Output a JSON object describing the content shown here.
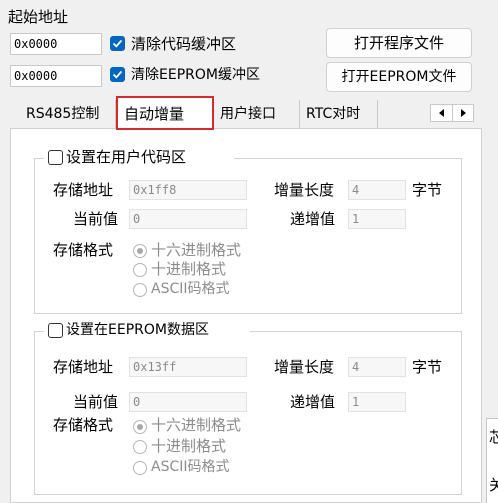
{
  "top": {
    "start_addr_label": "起始地址",
    "code_addr_value": "0x0000",
    "eeprom_addr_value": "0x0000",
    "clear_code_label": "清除代码缓冲区",
    "clear_eeprom_label": "清除EEPROM缓冲区",
    "open_program_label": "打开程序文件",
    "open_eeprom_label": "打开EEPROM文件"
  },
  "tabs": {
    "rs485": "RS485控制",
    "auto_inc": "自动增量",
    "user_if": "用户接口",
    "rtc": "RTC对时"
  },
  "code_group": {
    "title": "设置在用户代码区",
    "store_addr_label": "存储地址",
    "store_addr_value": "0x1ff8",
    "inc_len_label": "增量长度",
    "inc_len_value": "4",
    "unit": "字节",
    "current_label": "当前值",
    "current_value": "0",
    "step_label": "递增值",
    "step_value": "1",
    "format_label": "存储格式",
    "opt_hex": "十六进制格式",
    "opt_dec": "十进制格式",
    "opt_ascii": "ASCII码格式"
  },
  "eeprom_group": {
    "title": "设置在EEPROM数据区",
    "store_addr_label": "存储地址",
    "store_addr_value": "0x13ff",
    "inc_len_label": "增量长度",
    "inc_len_value": "4",
    "unit": "字节",
    "current_label": "当前值",
    "current_value": "0",
    "step_label": "递增值",
    "step_value": "1",
    "format_label": "存储格式",
    "opt_hex": "十六进制格式",
    "opt_dec": "十进制格式",
    "opt_ascii": "ASCII码格式"
  },
  "side": {
    "char_top": "芯",
    "char_bottom": "关"
  },
  "colors": {
    "accent": "#0067c0",
    "tab_highlight": "#d62a2a"
  }
}
